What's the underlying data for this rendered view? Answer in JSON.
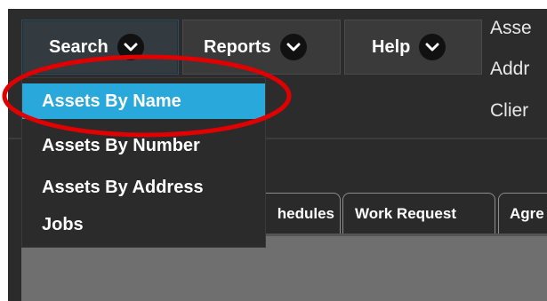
{
  "nav": {
    "search_label": "Search",
    "reports_label": "Reports",
    "help_label": "Help"
  },
  "side_labels": [
    "Asse",
    "Addr",
    "Clier"
  ],
  "dropdown": {
    "items": [
      {
        "label": "Assets By Name",
        "active": true
      },
      {
        "label": "Assets By Number",
        "active": false
      },
      {
        "label": "Assets By Address",
        "active": false
      },
      {
        "label": "Jobs",
        "active": false
      }
    ]
  },
  "tabs": [
    {
      "label": "hedules"
    },
    {
      "label": "Work Request"
    },
    {
      "label": "Agre"
    }
  ],
  "colors": {
    "accent": "#29a8dc",
    "highlight": "#e00000",
    "background": "#2b2b2b"
  }
}
